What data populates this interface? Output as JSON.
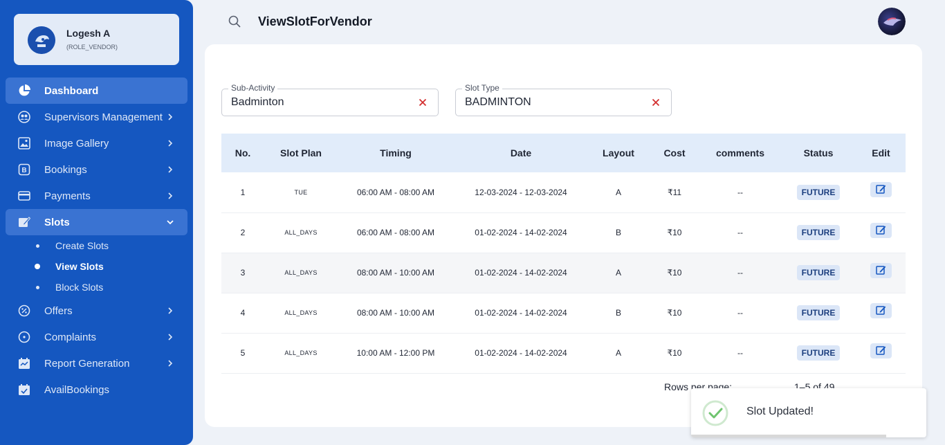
{
  "user": {
    "name": "Logesh A",
    "role": "(ROLE_VENDOR)"
  },
  "sidebar": {
    "items": [
      {
        "label": "Dashboard",
        "icon": "pie-chart-icon"
      },
      {
        "label": "Supervisors Management",
        "icon": "people-icon"
      },
      {
        "label": "Image Gallery",
        "icon": "gallery-icon"
      },
      {
        "label": "Bookings",
        "icon": "booking-icon"
      },
      {
        "label": "Payments",
        "icon": "card-icon"
      },
      {
        "label": "Slots",
        "icon": "edit-note-icon"
      },
      {
        "label": "Offers",
        "icon": "offer-icon"
      },
      {
        "label": "Complaints",
        "icon": "complaint-icon"
      },
      {
        "label": "Report Generation",
        "icon": "calendar-report-icon"
      },
      {
        "label": "AvailBookings",
        "icon": "calendar-check-icon"
      }
    ],
    "slots_sub": [
      "Create Slots",
      "View Slots",
      "Block Slots"
    ]
  },
  "header": {
    "title": "ViewSlotForVendor"
  },
  "filters": {
    "sub_activity": {
      "label": "Sub-Activity",
      "value": "Badminton"
    },
    "slot_type": {
      "label": "Slot Type",
      "value": "BADMINTON"
    }
  },
  "table": {
    "headers": [
      "No.",
      "Slot Plan",
      "Timing",
      "Date",
      "Layout",
      "Cost",
      "comments",
      "Status",
      "Edit"
    ],
    "rows": [
      [
        "1",
        "TUE",
        "06:00 AM - 08:00 AM",
        "12-03-2024 - 12-03-2024",
        "A",
        "₹11",
        "--",
        "FUTURE"
      ],
      [
        "2",
        "ALL_DAYS",
        "06:00 AM - 08:00 AM",
        "01-02-2024 - 14-02-2024",
        "B",
        "₹10",
        "--",
        "FUTURE"
      ],
      [
        "3",
        "ALL_DAYS",
        "08:00 AM - 10:00 AM",
        "01-02-2024 - 14-02-2024",
        "A",
        "₹10",
        "--",
        "FUTURE"
      ],
      [
        "4",
        "ALL_DAYS",
        "08:00 AM - 10:00 AM",
        "01-02-2024 - 14-02-2024",
        "B",
        "₹10",
        "--",
        "FUTURE"
      ],
      [
        "5",
        "ALL_DAYS",
        "10:00 AM - 12:00 PM",
        "01-02-2024 - 14-02-2024",
        "A",
        "₹10",
        "--",
        "FUTURE"
      ]
    ]
  },
  "pagination": {
    "rows_per_page_label": "Rows per page:",
    "range": "1–5 of 49"
  },
  "toast": {
    "message": "Slot Updated!",
    "progress": 0.83
  },
  "colors": {
    "sidebar": "#1557c0",
    "accent": "#3a73d2",
    "header_row": "#e1ecfa",
    "success": "#6fc46f"
  }
}
